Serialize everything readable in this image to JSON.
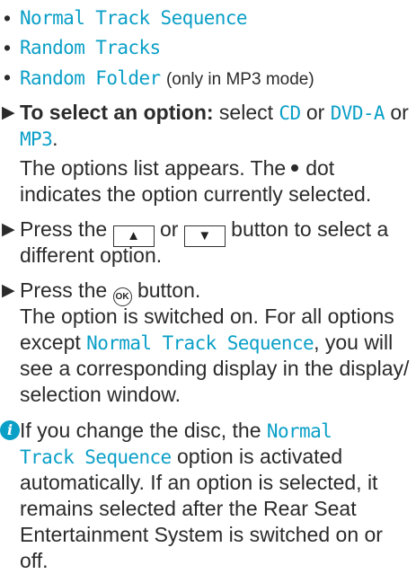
{
  "list": [
    {
      "bullet": "•",
      "option": "Normal Track Sequence",
      "note": ""
    },
    {
      "bullet": "•",
      "option": "Random Tracks",
      "note": ""
    },
    {
      "bullet": "•",
      "option": "Random Folder",
      "note": "(only in MP3 mode)"
    }
  ],
  "step1": {
    "marker": "▶",
    "bold_lead": "To select an option:",
    "t1": " select ",
    "opt1": "CD",
    "t2": " or ",
    "opt2": "DVD-A",
    "t3": " or",
    "opt3": "MP3",
    "t4": ".",
    "r1": "The options list appears. The",
    "r1b": "dot",
    "r2": "indicates the option currently selected."
  },
  "step2": {
    "marker": "▶",
    "t1": "Press the",
    "up_glyph": "▲",
    "or": "or",
    "down_glyph": "▼",
    "t2": "button to select a",
    "t3": "different option."
  },
  "step3": {
    "marker": "▶",
    "t1": "Press the",
    "ok_glyph": "OK",
    "t2": "button.",
    "r1": "The option is switched on. For all options",
    "r2a": "except",
    "r2opt": "Normal Track Sequence",
    "r2b": ", you will",
    "r3": "see a corresponding display in the display/",
    "r4": "selection window."
  },
  "note": {
    "icon": "i",
    "l1a": "If you change the disc, the",
    "l1opt": "Normal",
    "l2opt": "Track Sequence",
    "l2b": "option is activated",
    "l3": "automatically. If an option is selected, it",
    "l4": "remains selected after the Rear Seat",
    "l5": "Entertainment System is switched on or",
    "l6": "off."
  },
  "colors": {
    "accent": "#0a9fc7",
    "text": "#2b2b2b"
  }
}
